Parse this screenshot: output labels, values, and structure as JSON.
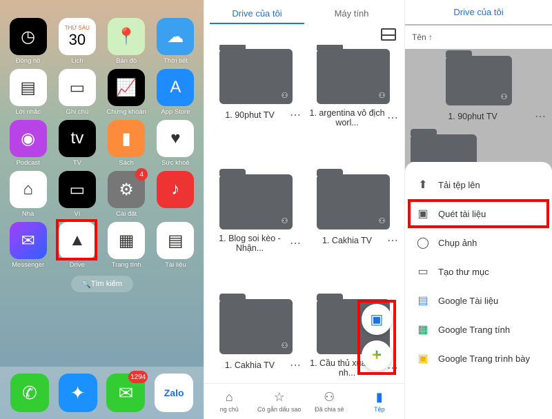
{
  "panelA": {
    "calendar": {
      "day": "THỨ SÁU",
      "date": "30"
    },
    "apps": [
      {
        "label": "Đồng hồ",
        "bg": "#000",
        "icon": "◷"
      },
      {
        "label": "Lịch",
        "type": "cal"
      },
      {
        "label": "Bản đồ",
        "bg": "#d0f0c0",
        "icon": "📍"
      },
      {
        "label": "Thời tiết",
        "bg": "#3ba0f0",
        "icon": "☁"
      },
      {
        "label": "Lời nhắc",
        "bg": "#fff",
        "icon": "▤"
      },
      {
        "label": "Ghi chú",
        "bg": "#fff",
        "icon": "▭"
      },
      {
        "label": "Chứng khoán",
        "bg": "#000",
        "icon": "📈"
      },
      {
        "label": "App Store",
        "bg": "#1e8cff",
        "icon": "A"
      },
      {
        "label": "Podcast",
        "bg": "#b843e6",
        "icon": "◉"
      },
      {
        "label": "TV",
        "bg": "#000",
        "icon": "tv"
      },
      {
        "label": "Sách",
        "bg": "#fc8c3c",
        "icon": "▮"
      },
      {
        "label": "Sức khoẻ",
        "bg": "#fff",
        "icon": "♥"
      },
      {
        "label": "Nhà",
        "bg": "#fff",
        "icon": "⌂"
      },
      {
        "label": "Ví",
        "bg": "#000",
        "icon": "▭"
      },
      {
        "label": "Cài đặt",
        "bg": "#777",
        "icon": "⚙",
        "badge": "4"
      },
      {
        "label": "",
        "bg": "#e33",
        "icon": "♪"
      },
      {
        "label": "Messenger",
        "bg": "linear-gradient(135deg,#a040ff,#3060ff)",
        "icon": "✉"
      },
      {
        "label": "Drive",
        "bg": "#fff",
        "icon": "▲",
        "hl": true
      },
      {
        "label": "Trang tính",
        "bg": "#fff",
        "icon": "▦"
      },
      {
        "label": "Tài liệu",
        "bg": "#fff",
        "icon": "▤"
      }
    ],
    "search": "Tìm kiếm",
    "dock": [
      {
        "bg": "#3c3",
        "icon": "✆"
      },
      {
        "bg": "#1b90ff",
        "icon": "✦"
      },
      {
        "bg": "#3c3",
        "icon": "✉",
        "badge": "1294"
      },
      {
        "bg": "#fff",
        "icon": "Zalo",
        "text": true
      }
    ]
  },
  "panelB": {
    "tabs": [
      "Drive của tôi",
      "Máy tính"
    ],
    "folders": [
      "1. 90phut TV",
      "1. argentina vô địch worl...",
      "1. Blog soi kèo - Nhận...",
      "1. Cakhia TV",
      "1. Cakhia TV",
      "1. Cầu thủ xuất sắc nh..."
    ],
    "bottomTabs": [
      {
        "icon": "⌂",
        "label": "ng chủ"
      },
      {
        "icon": "☆",
        "label": "Có gắn dấu sao"
      },
      {
        "icon": "⚇",
        "label": "Đã chia sẻ"
      },
      {
        "icon": "▮",
        "label": "Tệp",
        "active": true
      }
    ]
  },
  "panelC": {
    "header": "Drive của tôi",
    "sort": "Tên ↑",
    "folder": "1. 90phut TV",
    "sheet": [
      {
        "icon": "⬆",
        "label": "Tải tệp lên"
      },
      {
        "icon": "▣",
        "label": "Quét tài liệu",
        "hl": true
      },
      {
        "icon": "◯",
        "label": "Chụp ảnh"
      },
      {
        "icon": "▭",
        "label": "Tạo thư mục"
      },
      {
        "icon": "▤",
        "label": "Google Tài liệu",
        "color": "#4285f4"
      },
      {
        "icon": "▦",
        "label": "Google Trang tính",
        "color": "#0f9d58"
      },
      {
        "icon": "▣",
        "label": "Google Trang trình bày",
        "color": "#f4b400"
      }
    ]
  }
}
